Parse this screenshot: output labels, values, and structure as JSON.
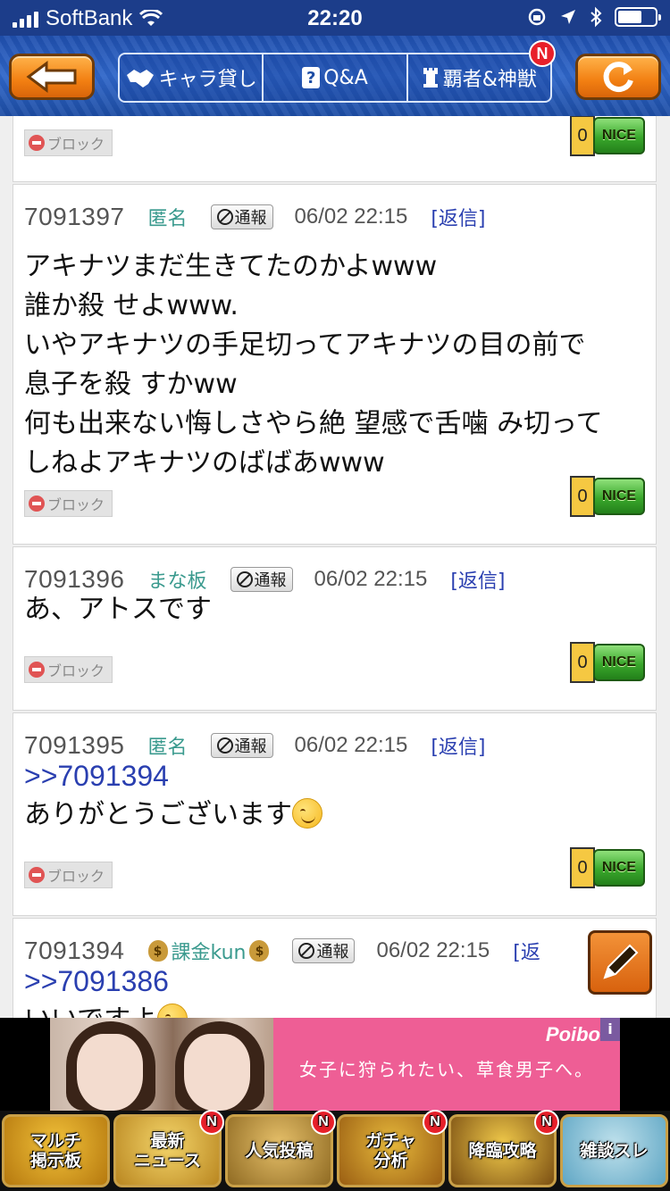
{
  "status_bar": {
    "carrier": "SoftBank",
    "time": "22:20"
  },
  "header": {
    "tabs": [
      {
        "label": "キャラ貸し",
        "icon": "handshake-icon"
      },
      {
        "label": "Q&A",
        "icon": "question-icon"
      },
      {
        "label": "覇者&神獣",
        "icon": "tower-icon",
        "badge": "N"
      }
    ]
  },
  "labels": {
    "block": "ブロック",
    "report": "通報",
    "reply": "[返信]",
    "nice": "NICE"
  },
  "posts": [
    {
      "id": "",
      "author": "",
      "date": "",
      "lines": [],
      "nice_count": "0"
    },
    {
      "id": "7091397",
      "author": "匿名",
      "date": "06/02 22:15",
      "lines": [
        "アキナツまだ生きてたのかよwww",
        "誰か殺 せよwww.",
        "いやアキナツの手足切ってアキナツの目の前で",
        "息子を殺 すかww",
        "何も出来ない悔しさやら絶 望感で舌噛 み切って",
        "しねよアキナツのばばあwww"
      ],
      "nice_count": "0"
    },
    {
      "id": "7091396",
      "author": "まな板",
      "date": "06/02 22:15",
      "lines": [
        "あ、アトスです"
      ],
      "nice_count": "0"
    },
    {
      "id": "7091395",
      "author": "匿名",
      "date": "06/02 22:15",
      "anchor": ">>7091394",
      "lines": [
        "ありがとうございます"
      ],
      "nice_count": "0"
    },
    {
      "id": "7091394",
      "author": "課金kun",
      "date": "06/02 22:15",
      "anchor": ">>7091386",
      "lines": [
        "いいですよ"
      ],
      "reply_partial": "[返"
    }
  ],
  "ad": {
    "brand": "Poibo",
    "copy": "女子に狩られたい、草食男子へ。",
    "info": "i"
  },
  "bottom_nav": [
    {
      "label": "マルチ\n掲示板"
    },
    {
      "label": "最新\nニュース",
      "badge": "N"
    },
    {
      "label": "人気投稿",
      "badge": "N"
    },
    {
      "label": "ガチャ\n分析",
      "badge": "N"
    },
    {
      "label": "降臨攻略",
      "badge": "N"
    },
    {
      "label": "雑談スレ"
    }
  ],
  "colors": {
    "header_blue": "#1f4fae",
    "accent_orange": "#f27f12",
    "link_blue": "#2a3fb0",
    "author_teal": "#3a9a8e",
    "nice_green": "#3aa82c",
    "badge_red": "#e8202a"
  }
}
